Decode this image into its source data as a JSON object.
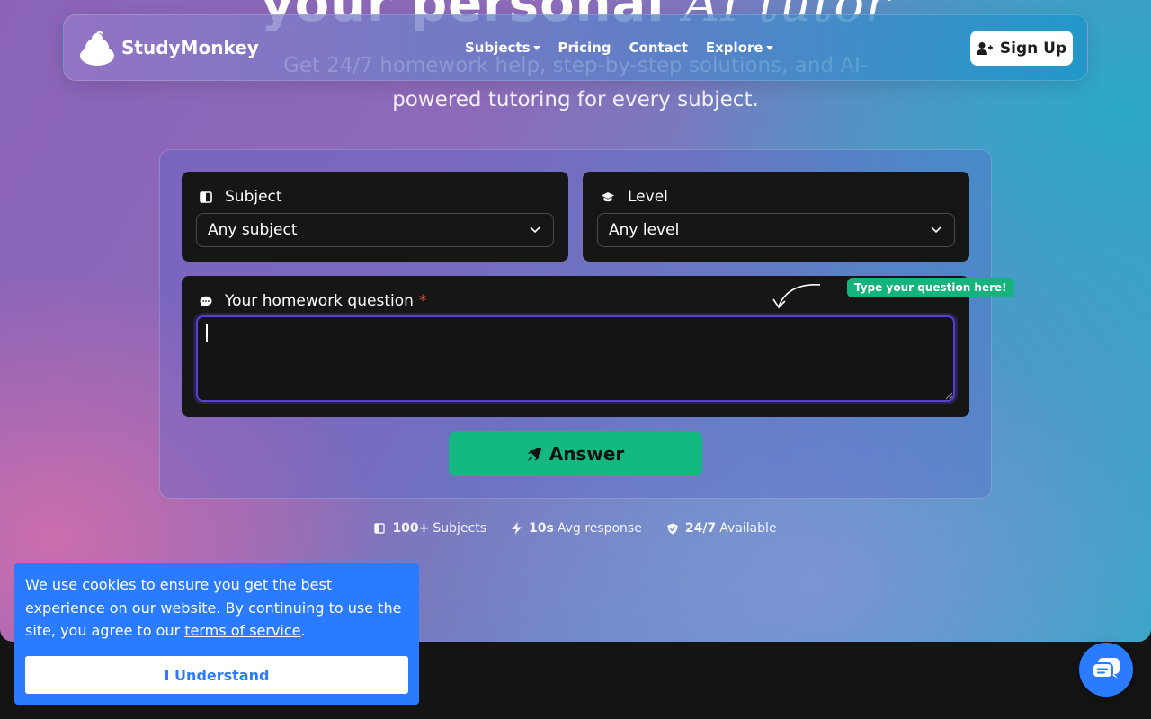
{
  "hero": {
    "headline_main": "your personal",
    "headline_accent": "AI tutor",
    "subtext": "Get 24/7 homework help, step-by-step solutions, and AI-powered tutoring for every subject."
  },
  "navbar": {
    "brand": "StudyMonkey",
    "links": [
      {
        "label": "Subjects",
        "dropdown": true
      },
      {
        "label": "Pricing",
        "dropdown": false
      },
      {
        "label": "Contact",
        "dropdown": false
      },
      {
        "label": "Explore",
        "dropdown": true
      }
    ],
    "signup_label": "Sign Up"
  },
  "form": {
    "subject": {
      "label": "Subject",
      "value": "Any subject",
      "icon": "book-icon"
    },
    "level": {
      "label": "Level",
      "value": "Any level",
      "icon": "graduation-cap-icon"
    },
    "question": {
      "label": "Your homework question",
      "required_mark": "*",
      "value": "",
      "icon": "chat-bubble-icon"
    },
    "hint": "Type your question here!",
    "answer_label": "Answer"
  },
  "stats": [
    {
      "value": "100+",
      "label": "Subjects",
      "icon": "book-icon"
    },
    {
      "value": "10s",
      "label": "Avg response",
      "icon": "bolt-icon"
    },
    {
      "value": "24/7",
      "label": "Available",
      "icon": "shield-check-icon"
    }
  ],
  "cookie": {
    "text": "We use cookies to ensure you get the best experience on our website. By continuing to use the site, you agree to our",
    "link": "terms of service",
    "end": ".",
    "button": "I Understand"
  },
  "colors": {
    "accent_green": "#14b981",
    "cookie_blue": "#2a7bff",
    "focus_purple": "#5a3fd1"
  }
}
